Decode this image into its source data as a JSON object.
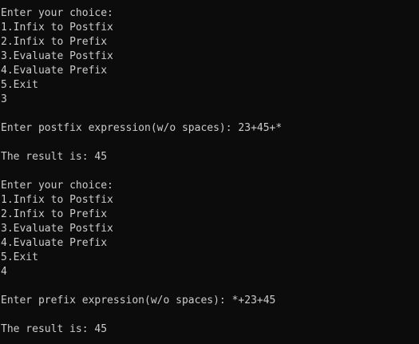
{
  "console": {
    "background": "#0c0c0c",
    "foreground": "#cccccc",
    "lines": [
      "Enter your choice:",
      "1.Infix to Postfix",
      "2.Infix to Prefix",
      "3.Evaluate Postfix",
      "4.Evaluate Prefix",
      "5.Exit",
      "3",
      "",
      "Enter postfix expression(w/o spaces): 23+45+*",
      "",
      "The result is: 45",
      "",
      "Enter your choice:",
      "1.Infix to Postfix",
      "2.Infix to Prefix",
      "3.Evaluate Postfix",
      "4.Evaluate Prefix",
      "5.Exit",
      "4",
      "",
      "Enter prefix expression(w/o spaces): *+23+45",
      "",
      "The result is: 45"
    ]
  }
}
